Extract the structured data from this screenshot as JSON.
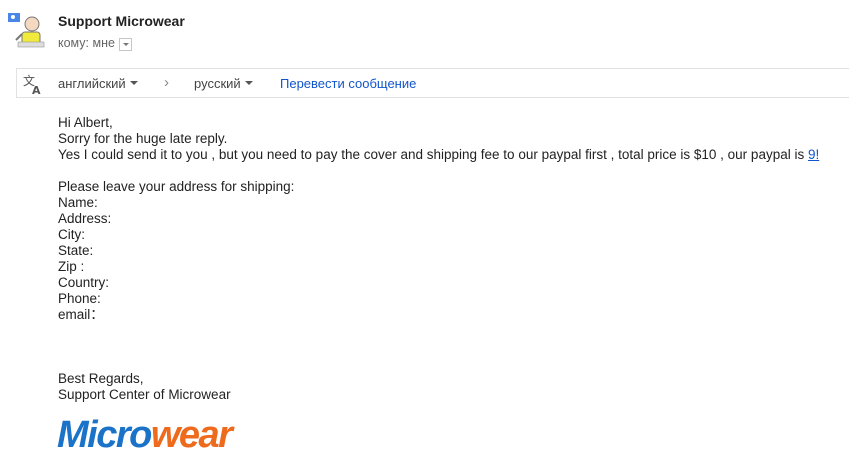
{
  "header": {
    "sender_name": "Support Microwear",
    "recipient_text": "кому: мне"
  },
  "translate_bar": {
    "source_lang": "английский",
    "target_lang": "русский",
    "translate_link": "Перевести сообщение"
  },
  "body": {
    "lines": [
      "Hi Albert,",
      "Sorry for the huge late reply.",
      "Yes I could send it to you , but you need to pay the cover and shipping fee to our paypal first , total price is $10 , our paypal is ",
      "",
      "Please leave your address for shipping:",
      "Name:",
      "Address:",
      "City:",
      "State:",
      "Zip :",
      "Country:",
      "Phone:",
      "email：",
      "",
      "",
      "",
      "Best Regards,",
      "Support Center of Microwear"
    ],
    "paypal_link_visible": "9!"
  },
  "logo": {
    "part1": "Micro",
    "part2": "wear"
  },
  "colors": {
    "link": "#1155cc",
    "logo_blue": "#1a73c8",
    "logo_orange": "#ee6a1d"
  }
}
